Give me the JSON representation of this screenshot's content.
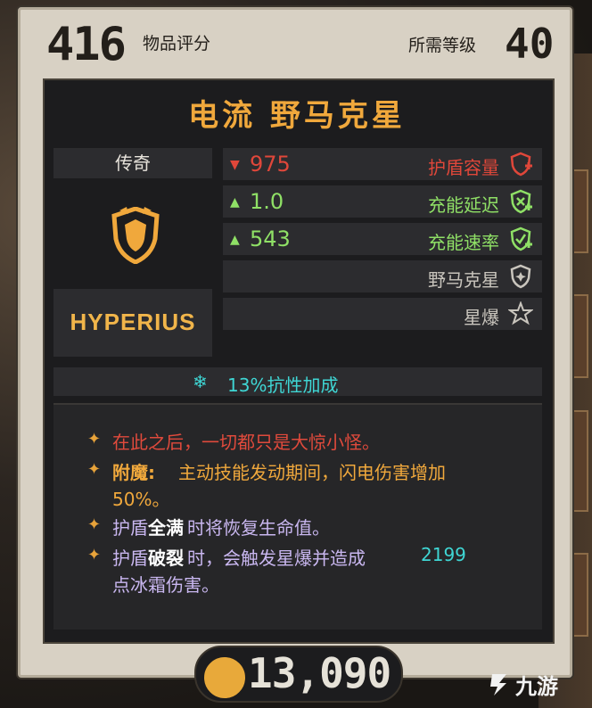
{
  "header": {
    "item_score": "416",
    "item_score_label": "物品评分",
    "required_level_label": "所需等级",
    "required_level": "40"
  },
  "item": {
    "name": "电流 野马克星",
    "rarity": "传奇",
    "manufacturer": "HYPERIUS"
  },
  "stats": [
    {
      "arrow": "▼",
      "value": "975",
      "name": "护盾容量",
      "icon": "shield-capacity-icon",
      "color": "#e0473a"
    },
    {
      "arrow": "▲",
      "value": "1.0",
      "name": "充能延迟",
      "icon": "recharge-delay-icon",
      "color": "#8fe066"
    },
    {
      "arrow": "▲",
      "value": "543",
      "name": "充能速率",
      "icon": "recharge-rate-icon",
      "color": "#8fe066"
    },
    {
      "arrow": "",
      "value": "",
      "name": "野马克星",
      "icon": "shield-icon",
      "color": "#c9c5bd"
    },
    {
      "arrow": "",
      "value": "",
      "name": "星爆",
      "icon": "starburst-icon",
      "color": "#c9c5bd"
    }
  ],
  "resistance": {
    "icon": "snowflake-icon",
    "text": "13%抗性加成"
  },
  "description": {
    "line1": "在此之后，一切都只是大惊小怪。",
    "line2_label": "附魔:",
    "line2_text": "主动技能发动期间，闪电伤害增加",
    "line2_cont": "50%。",
    "line3_a": "护盾",
    "line3_b": "全满",
    "line3_c": "时将恢复生命值。",
    "line4_a": "护盾",
    "line4_b": "破裂",
    "line4_c": "时，会触发星爆并造成",
    "line4_d": "2199",
    "line4_e": "点冰霜伤害。"
  },
  "price": "13,090",
  "watermark": "九游",
  "colors": {
    "title": "#f0a83c",
    "legendary_orange": "#f0a83c",
    "cyan": "#3fd6d4",
    "red_text": "#e0473a",
    "purple_text": "#c9b7f0",
    "panel": "#1c1c1e"
  }
}
